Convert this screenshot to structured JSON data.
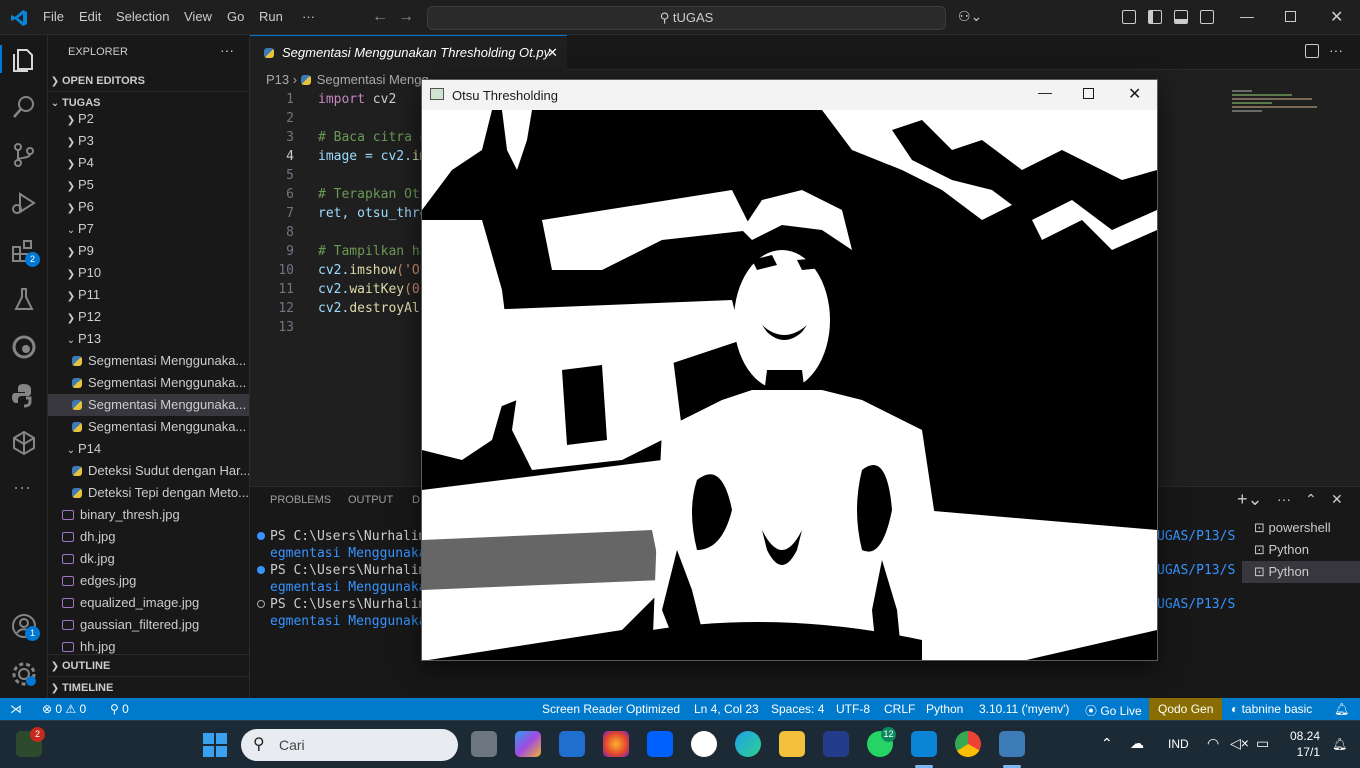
{
  "menu": [
    "File",
    "Edit",
    "Selection",
    "View",
    "Go",
    "Run",
    "···"
  ],
  "command_center": "tUGAS",
  "sidebar": {
    "title": "EXPLORER",
    "more": "···",
    "open_editors": "OPEN EDITORS",
    "root": "TUGAS",
    "folders_top": [
      "P2",
      "P3",
      "P4",
      "P5",
      "P6",
      "P7",
      "P9",
      "P10",
      "P11",
      "P12",
      "P13"
    ],
    "p13_files": [
      "Segmentasi Menggunaka...",
      "Segmentasi Menggunaka...",
      "Segmentasi Menggunaka...",
      "Segmentasi Menggunaka..."
    ],
    "p14": "P14",
    "p14_files": [
      "Deteksi Sudut dengan Har...",
      "Deteksi Tepi dengan Meto..."
    ],
    "images": [
      "binary_thresh.jpg",
      "dh.jpg",
      "dk.jpg",
      "edges.jpg",
      "equalized_image.jpg",
      "gaussian_filtered.jpg",
      "hh.jpg"
    ],
    "outline": "OUTLINE",
    "timeline": "TIMELINE"
  },
  "activity_badges": {
    "extensions": "2",
    "accounts": "1"
  },
  "tab": {
    "label": "Segmentasi Menggunakan Thresholding Ot.py",
    "close": "✕"
  },
  "breadcrumb": [
    "P13",
    "Segmentasi Mengg"
  ],
  "code": {
    "line_numbers": [
      "1",
      "2",
      "3",
      "4",
      "5",
      "6",
      "7",
      "8",
      "9",
      "10",
      "11",
      "12",
      "13"
    ],
    "lines": [
      {
        "kw": "import",
        "rest": " cv2"
      },
      {
        "kw": "",
        "rest": ""
      },
      {
        "comment": "# Baca citra g"
      },
      {
        "plain": "image = cv2.",
        "fn": "im"
      },
      {
        "kw": "",
        "rest": ""
      },
      {
        "comment": "# Terapkan Ots"
      },
      {
        "plain": "ret, otsu_thre"
      },
      {
        "kw": "",
        "rest": ""
      },
      {
        "comment": "# Tampilkan ha"
      },
      {
        "plain": "cv2.",
        "fn": "imshow",
        "str": "('Ot"
      },
      {
        "plain": "cv2.",
        "fn": "waitKey",
        "str": "(0"
      },
      {
        "plain": "cv2.",
        "fn": "destroyAl"
      },
      {
        "kw": "",
        "rest": ""
      }
    ]
  },
  "panel": {
    "tabs": [
      "PROBLEMS",
      "OUTPUT",
      "D"
    ],
    "terminal_lines": [
      {
        "prompt": "PS C:\\Users\\Nurhalim\\C",
        "cont": "egmentasi Menggunakan",
        "right": "UGAS/P13/S"
      },
      {
        "prompt": "PS C:\\Users\\Nurhalim\\C",
        "cont": "egmentasi Menggunakan",
        "right": "UGAS/P13/S"
      },
      {
        "prompt": "PS C:\\Users\\Nurhalim\\C",
        "cont": "egmentasi Menggunakan",
        "right": "UGAS/P13/S"
      }
    ],
    "terminals": [
      "powershell",
      "Python",
      "Python"
    ]
  },
  "popup": {
    "title": "Otsu Thresholding"
  },
  "status": {
    "remote": "⋊",
    "problems": "⊗ 0 ⚠ 0",
    "ports": "⚲ 0",
    "screen_reader": "Screen Reader Optimized",
    "position": "Ln 4, Col 23",
    "spaces": "Spaces: 4",
    "encoding": "UTF-8",
    "eol": "CRLF",
    "language": "Python",
    "interpreter": "3.10.11 ('myenv')",
    "golive": "Go Live",
    "qodo": "Qodo Gen",
    "tabnine": "tabnine basic"
  },
  "taskbar": {
    "search_placeholder": "Cari",
    "widget_badge": "2",
    "whatsapp_badge": "12",
    "lang": "IND",
    "time": "08.24",
    "date": "17/1"
  },
  "colors": {
    "accent": "#0078d4",
    "status": "#007acc",
    "qodo": "#8a6d00",
    "keyword": "#c586c0",
    "function": "#dcdcaa",
    "string": "#ce9178",
    "comment": "#6a9955"
  }
}
